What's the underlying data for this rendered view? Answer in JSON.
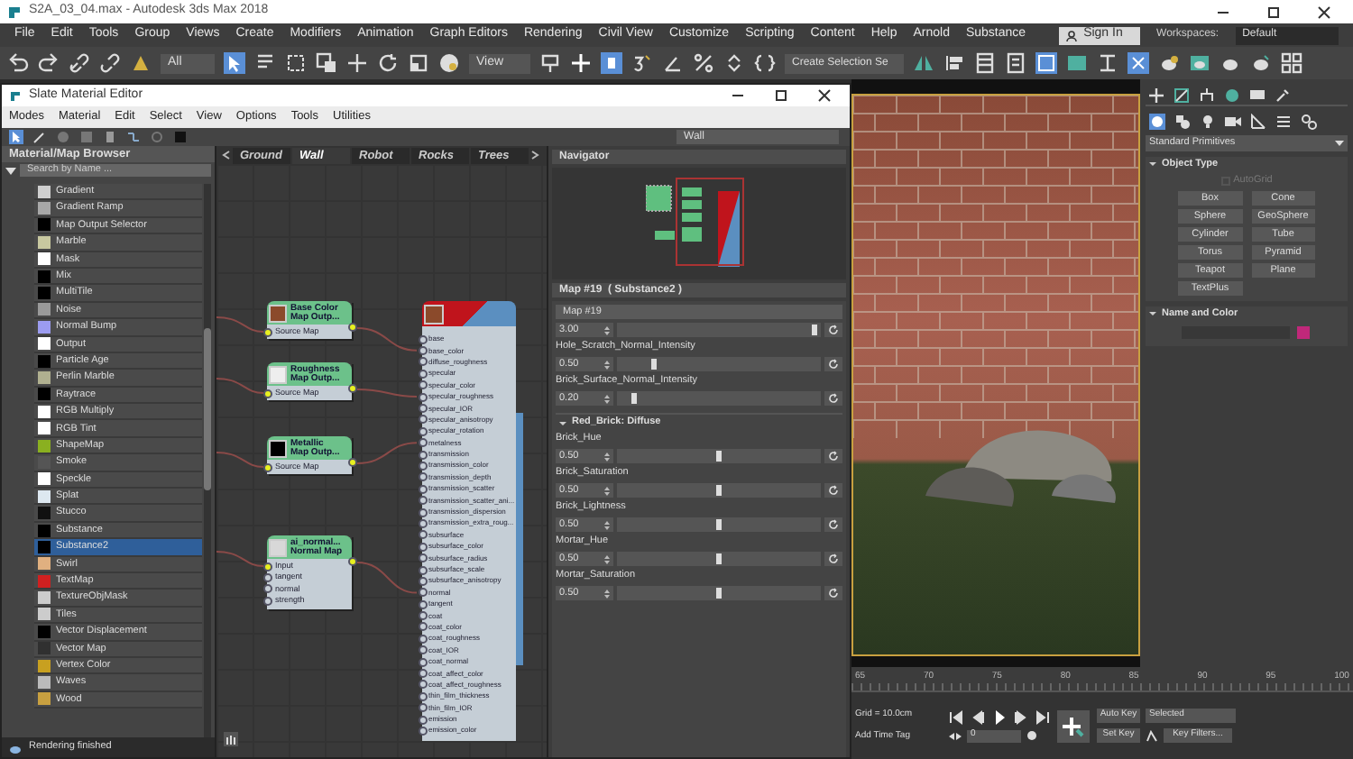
{
  "window": {
    "title": "S2A_03_04.max - Autodesk 3ds Max 2018"
  },
  "menu": [
    "File",
    "Edit",
    "Tools",
    "Group",
    "Views",
    "Create",
    "Modifiers",
    "Animation",
    "Graph Editors",
    "Rendering",
    "Civil View",
    "Customize",
    "Scripting",
    "Content",
    "Help",
    "Arnold",
    "Substance"
  ],
  "account": {
    "sign_in": "Sign In",
    "workspaces_label": "Workspaces:",
    "workspace": "Default"
  },
  "toolbar": {
    "filter": "All",
    "reference": "View",
    "selection_set": "Create Selection Se"
  },
  "slate": {
    "title": "Slate Material Editor",
    "menu": [
      "Modes",
      "Material",
      "Edit",
      "Select",
      "View",
      "Options",
      "Tools",
      "Utilities"
    ],
    "view_dropdown": "Wall",
    "browser": {
      "title": "Material/Map Browser",
      "search_placeholder": "Search by Name ...",
      "items": [
        {
          "label": "Gradient",
          "color": "#cfcfcf",
          "selected": false
        },
        {
          "label": "Gradient Ramp",
          "color": "#a8a8a8",
          "selected": false
        },
        {
          "label": "Map Output Selector",
          "color": "#000000",
          "selected": false
        },
        {
          "label": "Marble",
          "color": "#c8c8a0",
          "selected": false
        },
        {
          "label": "Mask",
          "color": "#ffffff",
          "selected": false
        },
        {
          "label": "Mix",
          "color": "#000000",
          "selected": false
        },
        {
          "label": "MultiTile",
          "color": "#000000",
          "selected": false
        },
        {
          "label": "Noise",
          "color": "#9a9a9a",
          "selected": false
        },
        {
          "label": "Normal Bump",
          "color": "#9c9cf0",
          "selected": false
        },
        {
          "label": "Output",
          "color": "#ffffff",
          "selected": false
        },
        {
          "label": "Particle Age",
          "color": "#000000",
          "selected": false
        },
        {
          "label": "Perlin Marble",
          "color": "#b0b090",
          "selected": false
        },
        {
          "label": "Raytrace",
          "color": "#000000",
          "selected": false
        },
        {
          "label": "RGB Multiply",
          "color": "#ffffff",
          "selected": false
        },
        {
          "label": "RGB Tint",
          "color": "#ffffff",
          "selected": false
        },
        {
          "label": "ShapeMap",
          "color": "#8ab020",
          "selected": false
        },
        {
          "label": "Smoke",
          "color": "#555555",
          "selected": false
        },
        {
          "label": "Speckle",
          "color": "#ffffff",
          "selected": false
        },
        {
          "label": "Splat",
          "color": "#dde8f0",
          "selected": false
        },
        {
          "label": "Stucco",
          "color": "#111111",
          "selected": false
        },
        {
          "label": "Substance",
          "color": "#000000",
          "selected": false
        },
        {
          "label": "Substance2",
          "color": "#000000",
          "selected": true
        },
        {
          "label": "Swirl",
          "color": "#e0b080",
          "selected": false
        },
        {
          "label": "TextMap",
          "color": "#d02020",
          "selected": false
        },
        {
          "label": "TextureObjMask",
          "color": "#cccccc",
          "selected": false
        },
        {
          "label": "Tiles",
          "color": "#cccccc",
          "selected": false
        },
        {
          "label": "Vector Displacement",
          "color": "#000000",
          "selected": false
        },
        {
          "label": "Vector Map",
          "color": "#303030",
          "selected": false
        },
        {
          "label": "Vertex Color",
          "color": "#c8a020",
          "selected": false
        },
        {
          "label": "Waves",
          "color": "#bbbbbb",
          "selected": false
        },
        {
          "label": "Wood",
          "color": "#c8a040",
          "selected": false
        }
      ]
    },
    "status": "Rendering finished",
    "view_tabs": [
      {
        "label": "Ground",
        "selected": false
      },
      {
        "label": "Wall",
        "selected": true
      },
      {
        "label": "Robot",
        "selected": false
      },
      {
        "label": "Rocks",
        "selected": false
      },
      {
        "label": "Trees",
        "selected": false
      }
    ],
    "map_nodes": [
      {
        "title": "Base Color",
        "subtitle": "Map Outp...",
        "color": "#8b4a2b",
        "ports": [
          "Source Map"
        ]
      },
      {
        "title": "Roughness",
        "subtitle": "Map Outp...",
        "color": "#eeeeee",
        "ports": [
          "Source Map"
        ]
      },
      {
        "title": "Metallic",
        "subtitle": "Map Outp...",
        "color": "#000000",
        "ports": [
          "Source Map"
        ]
      },
      {
        "title": "ai_normal...",
        "subtitle": "Normal Map",
        "color": "#d8d8d8",
        "ports": [
          "Input",
          "tangent",
          "normal",
          "strength"
        ]
      }
    ],
    "material_node": {
      "ports": [
        "base",
        "base_color",
        "diffuse_roughness",
        "specular",
        "specular_color",
        "specular_roughness",
        "specular_IOR",
        "specular_anisotropy",
        "specular_rotation",
        "metalness",
        "transmission",
        "transmission_color",
        "transmission_depth",
        "transmission_scatter",
        "transmission_scatter_ani...",
        "transmission_dispersion",
        "transmission_extra_roug...",
        "subsurface",
        "subsurface_color",
        "subsurface_radius",
        "subsurface_scale",
        "subsurface_anisotropy",
        "normal",
        "tangent",
        "coat",
        "coat_color",
        "coat_roughness",
        "coat_IOR",
        "coat_normal",
        "coat_affect_color",
        "coat_affect_roughness",
        "thin_film_thickness",
        "thin_film_IOR",
        "emission",
        "emission_color"
      ]
    },
    "navigator": {
      "title": "Navigator"
    },
    "parameters": {
      "title": "Map #19  ( Substance2 )",
      "name": "Map #19",
      "rows": [
        {
          "kind": "slider",
          "value": "3.00",
          "level": 0.97
        },
        {
          "kind": "slider",
          "label": "Hole_Scratch_Normal_Intensity",
          "value": "0.50",
          "level": 0.18
        },
        {
          "kind": "slider",
          "label": "Brick_Surface_Normal_Intensity",
          "value": "0.20",
          "level": 0.08
        },
        {
          "kind": "section",
          "label": "Red_Brick: Diffuse"
        },
        {
          "kind": "slider",
          "label": "Brick_Hue",
          "value": "0.50",
          "level": 0.5
        },
        {
          "kind": "slider",
          "label": "Brick_Saturation",
          "value": "0.50",
          "level": 0.5
        },
        {
          "kind": "slider",
          "label": "Brick_Lightness",
          "value": "0.50",
          "level": 0.5
        },
        {
          "kind": "slider",
          "label": "Mortar_Hue",
          "value": "0.50",
          "level": 0.5
        },
        {
          "kind": "slider",
          "label": "Mortar_Saturation",
          "value": "0.50",
          "level": 0.5
        }
      ]
    }
  },
  "command_panel": {
    "category": "Standard Primitives",
    "object_type": {
      "title": "Object Type",
      "autogrid": {
        "label": "AutoGrid",
        "disabled": true
      },
      "buttons": [
        "Box",
        "Cone",
        "Sphere",
        "GeoSphere",
        "Cylinder",
        "Tube",
        "Torus",
        "Pyramid",
        "Teapot",
        "Plane",
        "TextPlus"
      ]
    },
    "name_and_color": {
      "title": "Name and Color",
      "color": "#c0287a"
    }
  },
  "timeline": {
    "ticks": [
      "65",
      "70",
      "75",
      "80",
      "85",
      "90",
      "95",
      "100"
    ],
    "grid": "Grid = 10.0cm",
    "add_time_tag": "Add Time Tag",
    "frame": "0",
    "auto_key": "Auto Key",
    "key_mode": "Selected",
    "set_key": "Set Key",
    "key_filters": "Key Filters..."
  }
}
